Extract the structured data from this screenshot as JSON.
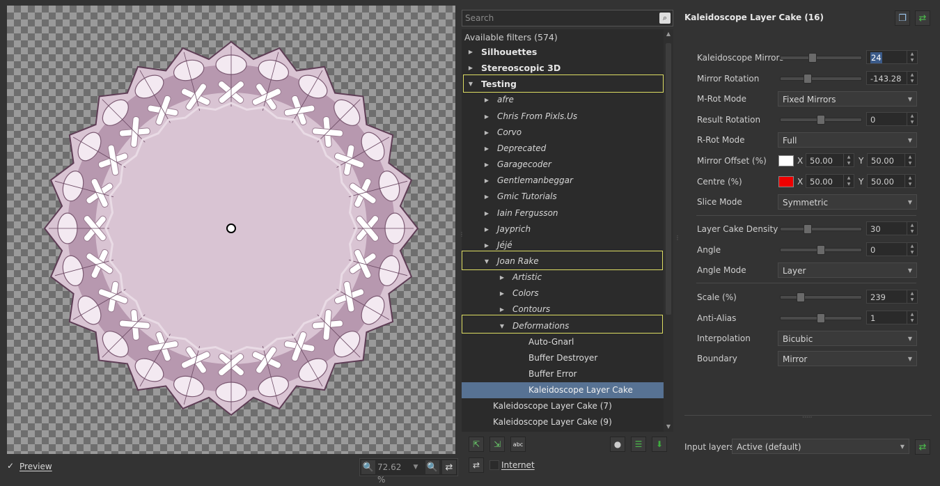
{
  "preview": {
    "preview_label": "Preview",
    "zoom_value": "72.62 %"
  },
  "filters": {
    "search_placeholder": "Search",
    "available": "Available filters (574)",
    "rows": [
      {
        "label": "Silhouettes",
        "level": 0,
        "arrow": "right"
      },
      {
        "label": "Stereoscopic 3D",
        "level": 0,
        "arrow": "right"
      },
      {
        "label": "Testing",
        "level": 0,
        "arrow": "down"
      },
      {
        "label": "afre",
        "level": 1,
        "arrow": "right"
      },
      {
        "label": "Chris From Pixls.Us",
        "level": 1,
        "arrow": "right"
      },
      {
        "label": "Corvo",
        "level": 1,
        "arrow": "right"
      },
      {
        "label": "Deprecated",
        "level": 1,
        "arrow": "right"
      },
      {
        "label": "Garagecoder",
        "level": 1,
        "arrow": "right"
      },
      {
        "label": "Gentlemanbeggar",
        "level": 1,
        "arrow": "right"
      },
      {
        "label": "Gmic Tutorials",
        "level": 1,
        "arrow": "right"
      },
      {
        "label": "Iain Fergusson",
        "level": 1,
        "arrow": "right"
      },
      {
        "label": "Jayprich",
        "level": 1,
        "arrow": "right"
      },
      {
        "label": "Jéjé",
        "level": 1,
        "arrow": "right"
      },
      {
        "label": "Joan Rake",
        "level": 1,
        "arrow": "down"
      },
      {
        "label": "Artistic",
        "level": 2,
        "arrow": "right"
      },
      {
        "label": "Colors",
        "level": 2,
        "arrow": "right"
      },
      {
        "label": "Contours",
        "level": 2,
        "arrow": "right"
      },
      {
        "label": "Deformations",
        "level": 2,
        "arrow": "down"
      },
      {
        "label": "Auto-Gnarl",
        "level": 3,
        "arrow": ""
      },
      {
        "label": "Buffer Destroyer",
        "level": 3,
        "arrow": ""
      },
      {
        "label": "Buffer Error",
        "level": 3,
        "arrow": ""
      },
      {
        "label": "Kaleidoscope Layer Cake",
        "level": 3,
        "arrow": "",
        "selected": true
      },
      {
        "label": "Kaleidoscope Layer Cake (7)",
        "level": 4,
        "arrow": ""
      },
      {
        "label": "Kaleidoscope Layer Cake (9)",
        "level": 4,
        "arrow": ""
      }
    ],
    "internet_label": "Internet"
  },
  "params": {
    "title": "Kaleidoscope Layer Cake (16)",
    "kaleidoscope_mirrors": {
      "label": "Kaleidoscope Mirrors",
      "value": "24",
      "fraction": 0.38
    },
    "mirror_rotation": {
      "label": "Mirror Rotation",
      "value": "-143.28",
      "fraction": 0.32
    },
    "m_rot_mode": {
      "label": "M-Rot Mode",
      "value": "Fixed Mirrors"
    },
    "result_rotation": {
      "label": "Result Rotation",
      "value": "0",
      "fraction": 0.5
    },
    "r_rot_mode": {
      "label": "R-Rot Mode",
      "value": "Full"
    },
    "mirror_offset": {
      "label": "Mirror Offset (%)",
      "x_label": "X",
      "x": "50.00",
      "y_label": "Y",
      "y": "50.00",
      "color": "#ffffff"
    },
    "centre": {
      "label": "Centre (%)",
      "x_label": "X",
      "x": "50.00",
      "y_label": "Y",
      "y": "50.00",
      "color": "#ee0000"
    },
    "slice_mode": {
      "label": "Slice Mode",
      "value": "Symmetric"
    },
    "layer_cake_density": {
      "label": "Layer Cake Density",
      "value": "30",
      "fraction": 0.32
    },
    "angle": {
      "label": "Angle",
      "value": "0",
      "fraction": 0.5
    },
    "angle_mode": {
      "label": "Angle Mode",
      "value": "Layer"
    },
    "scale": {
      "label": "Scale (%)",
      "value": "239",
      "fraction": 0.22
    },
    "anti_alias": {
      "label": "Anti-Alias",
      "value": "1",
      "fraction": 0.5
    },
    "interpolation": {
      "label": "Interpolation",
      "value": "Bicubic"
    },
    "boundary": {
      "label": "Boundary",
      "value": "Mirror"
    },
    "input_layers_label": "Input layers",
    "input_layers_value": "Active (default)"
  },
  "colors": {
    "selection": "#577293",
    "highlight_box": "#dede63",
    "accent_green": "#3fae3f"
  }
}
